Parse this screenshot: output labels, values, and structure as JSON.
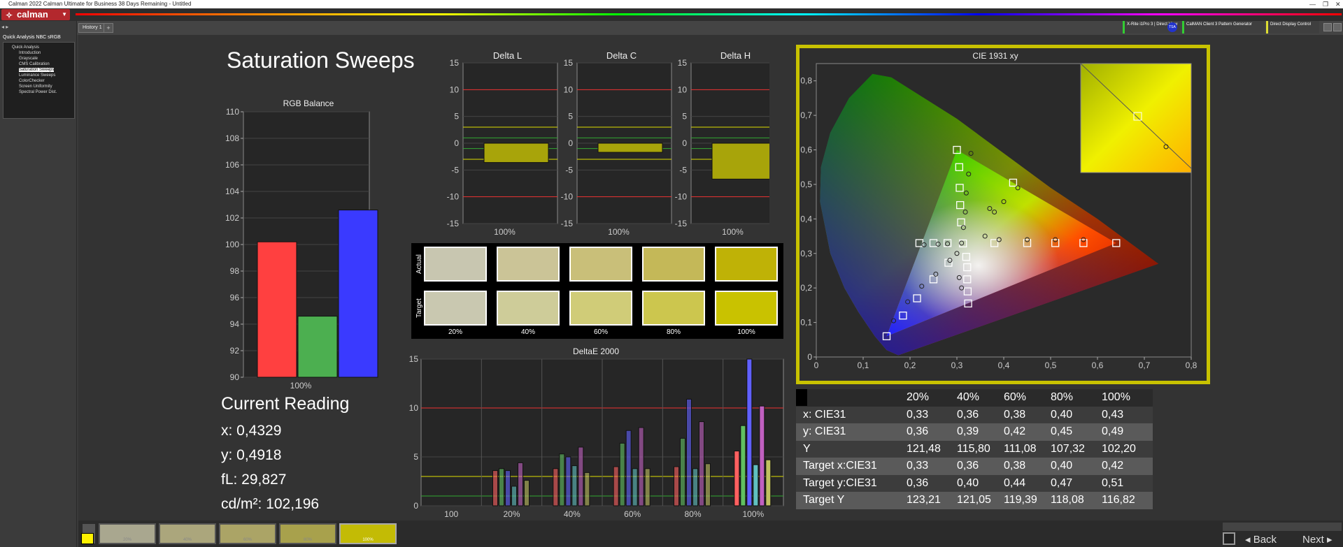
{
  "app": {
    "window_title": "Calman 2022 Calman Ultimate for Business 38 Days Remaining  - Untitled",
    "logo_text": "calman",
    "history_tab": "History 1"
  },
  "devices": {
    "meter": "X-Rite i1Pro 3 | Direct View",
    "pattern_generator": "CalMAN Client 3 Pattern Generator",
    "display_control": "Direct Display Control"
  },
  "sidebar": {
    "title": "Quick Analysis NBC sRGB",
    "root": "Quick Analysis",
    "items": [
      {
        "label": "Introduction",
        "selected": false
      },
      {
        "label": "Grayscale",
        "selected": false
      },
      {
        "label": "CMS Calibration",
        "selected": false
      },
      {
        "label": "Saturation Sweeps",
        "selected": true
      },
      {
        "label": "Luminance Sweeps",
        "selected": false
      },
      {
        "label": "ColorChecker",
        "selected": false
      },
      {
        "label": "Screen Uniformity",
        "selected": false
      },
      {
        "label": "Spectral Power Dist.",
        "selected": false
      }
    ]
  },
  "page": {
    "title": "Saturation Sweeps"
  },
  "rgb_balance": {
    "title": "RGB Balance",
    "y_ticks": [
      "110",
      "108",
      "106",
      "104",
      "102",
      "100",
      "98",
      "96",
      "94",
      "92",
      "90"
    ],
    "x_label": "100%",
    "colors": {
      "red": "#ff4040",
      "green": "#4caf50",
      "blue": "#3a3aff"
    }
  },
  "delta_panels": [
    {
      "title": "Delta L",
      "x_label": "100%"
    },
    {
      "title": "Delta C",
      "x_label": "100%"
    },
    {
      "title": "Delta H",
      "x_label": "100%"
    }
  ],
  "delta_y_ticks": [
    "15",
    "10",
    "5",
    "0",
    "-5",
    "-10",
    "-15"
  ],
  "swatches": {
    "actual_label": "Actual",
    "target_label": "Target",
    "labels": [
      "20%",
      "40%",
      "60%",
      "80%",
      "100%"
    ],
    "actual_colors": [
      "#c8c6b0",
      "#cbc497",
      "#c9bf79",
      "#c4b858",
      "#bfb206"
    ],
    "target_colors": [
      "#c9c8b0",
      "#cecc99",
      "#d0cc78",
      "#ccc64e",
      "#c9c200"
    ]
  },
  "deltae": {
    "title": "DeltaE 2000",
    "y_ticks": [
      "15",
      "10",
      "5",
      "0"
    ],
    "x_labels": [
      "100",
      "20%",
      "40%",
      "60%",
      "80%",
      "100%"
    ]
  },
  "cie": {
    "title": "CIE 1931 xy",
    "x_ticks": [
      "0",
      "0,1",
      "0,2",
      "0,3",
      "0,4",
      "0,5",
      "0,6",
      "0,7",
      "0,8"
    ],
    "y_ticks": [
      "0,8",
      "0,7",
      "0,6",
      "0,5",
      "0,4",
      "0,3",
      "0,2",
      "0,1",
      "0"
    ]
  },
  "current_reading": {
    "title": "Current Reading",
    "x": "x: 0,4329",
    "y": "y: 0,4918",
    "fl": "fL: 29,827",
    "cdm2": "cd/m²: 102,196"
  },
  "table": {
    "headers": [
      "20%",
      "40%",
      "60%",
      "80%",
      "100%"
    ],
    "rows": [
      {
        "label": "x: CIE31",
        "values": [
          "0,33",
          "0,36",
          "0,38",
          "0,40",
          "0,43"
        ]
      },
      {
        "label": "y: CIE31",
        "values": [
          "0,36",
          "0,39",
          "0,42",
          "0,45",
          "0,49"
        ]
      },
      {
        "label": "Y",
        "values": [
          "121,48",
          "115,80",
          "111,08",
          "107,32",
          "102,20"
        ]
      },
      {
        "label": "Target x:CIE31",
        "values": [
          "0,33",
          "0,36",
          "0,38",
          "0,40",
          "0,42"
        ]
      },
      {
        "label": "Target y:CIE31",
        "values": [
          "0,36",
          "0,40",
          "0,44",
          "0,47",
          "0,51"
        ]
      },
      {
        "label": "Target Y",
        "values": [
          "123,21",
          "121,05",
          "119,39",
          "118,08",
          "116,82"
        ]
      }
    ]
  },
  "bottom": {
    "swatch_labels": [
      "20%",
      "40%",
      "60%",
      "80%",
      "100%"
    ],
    "swatch_colors": [
      "#a9a78f",
      "#aba67c",
      "#aba466",
      "#a8a14c",
      "#c3bb05"
    ],
    "back": "Back",
    "next": "Next"
  },
  "chart_data": [
    {
      "type": "bar",
      "title": "RGB Balance",
      "categories": [
        "100%"
      ],
      "series": [
        {
          "values": [
            100.2
          ]
        },
        {
          "values": [
            94.6
          ]
        },
        {
          "values": [
            102.6
          ]
        }
      ],
      "ylim": [
        90,
        110
      ]
    },
    {
      "type": "bar",
      "title": "Delta L",
      "categories": [
        "100%"
      ],
      "values": [
        -3.6
      ],
      "ylim": [
        -15,
        15
      ]
    },
    {
      "type": "bar",
      "title": "Delta C",
      "categories": [
        "100%"
      ],
      "values": [
        -1.7
      ],
      "ylim": [
        -15,
        15
      ]
    },
    {
      "type": "bar",
      "title": "Delta H",
      "categories": [
        "100%"
      ],
      "values": [
        -6.7
      ],
      "ylim": [
        -15,
        15
      ]
    },
    {
      "type": "bar",
      "title": "DeltaE 2000",
      "groups": [
        "100",
        "20%",
        "40%",
        "60%",
        "80%",
        "100%"
      ],
      "series": [
        {
          "color": "#ff6060",
          "values": [
            0,
            3.6,
            3.8,
            4.0,
            4.0,
            5.6
          ]
        },
        {
          "color": "#60c060",
          "values": [
            0,
            3.8,
            5.3,
            6.4,
            6.9,
            8.2
          ]
        },
        {
          "color": "#6060ff",
          "values": [
            0,
            3.6,
            5.0,
            7.7,
            10.9,
            15.0
          ]
        },
        {
          "color": "#60c0c0",
          "values": [
            0,
            2.0,
            4.1,
            3.8,
            3.8,
            4.2
          ]
        },
        {
          "color": "#c060c0",
          "values": [
            0,
            4.4,
            6.0,
            8.0,
            8.6,
            10.2
          ]
        },
        {
          "color": "#c0c060",
          "values": [
            0,
            2.6,
            3.4,
            3.8,
            4.3,
            4.7
          ]
        }
      ],
      "ylim": [
        0,
        15
      ]
    },
    {
      "type": "scatter",
      "title": "CIE 1931 xy",
      "series": [
        {
          "name": "Target",
          "points": [
            [
              0.313,
              0.329
            ],
            [
              0.3,
              0.6
            ],
            [
              0.305,
              0.55
            ],
            [
              0.306,
              0.49
            ],
            [
              0.307,
              0.44
            ],
            [
              0.309,
              0.39
            ],
            [
              0.22,
              0.33
            ],
            [
              0.25,
              0.33
            ],
            [
              0.28,
              0.33
            ],
            [
              0.64,
              0.33
            ],
            [
              0.57,
              0.33
            ],
            [
              0.51,
              0.33
            ],
            [
              0.45,
              0.33
            ],
            [
              0.38,
              0.33
            ],
            [
              0.15,
              0.06
            ],
            [
              0.185,
              0.12
            ],
            [
              0.215,
              0.17
            ],
            [
              0.25,
              0.225
            ],
            [
              0.282,
              0.273
            ],
            [
              0.32,
              0.29
            ],
            [
              0.322,
              0.26
            ],
            [
              0.322,
              0.225
            ],
            [
              0.323,
              0.19
            ],
            [
              0.324,
              0.155
            ],
            [
              0.42,
              0.505
            ]
          ]
        },
        {
          "name": "Actual",
          "points": [
            [
              0.31,
              0.33
            ],
            [
              0.33,
              0.59
            ],
            [
              0.325,
              0.53
            ],
            [
              0.32,
              0.475
            ],
            [
              0.318,
              0.42
            ],
            [
              0.314,
              0.375
            ],
            [
              0.23,
              0.325
            ],
            [
              0.26,
              0.327
            ],
            [
              0.28,
              0.328
            ],
            [
              0.57,
              0.34
            ],
            [
              0.51,
              0.34
            ],
            [
              0.45,
              0.34
            ],
            [
              0.39,
              0.34
            ],
            [
              0.36,
              0.35
            ],
            [
              0.165,
              0.105
            ],
            [
              0.195,
              0.16
            ],
            [
              0.225,
              0.205
            ],
            [
              0.255,
              0.24
            ],
            [
              0.285,
              0.28
            ],
            [
              0.3,
              0.3
            ],
            [
              0.305,
              0.23
            ],
            [
              0.31,
              0.2
            ],
            [
              0.37,
              0.43
            ],
            [
              0.38,
              0.42
            ],
            [
              0.4,
              0.45
            ],
            [
              0.43,
              0.49
            ]
          ]
        }
      ],
      "xlim": [
        0,
        0.8
      ],
      "ylim": [
        0,
        0.85
      ]
    }
  ]
}
